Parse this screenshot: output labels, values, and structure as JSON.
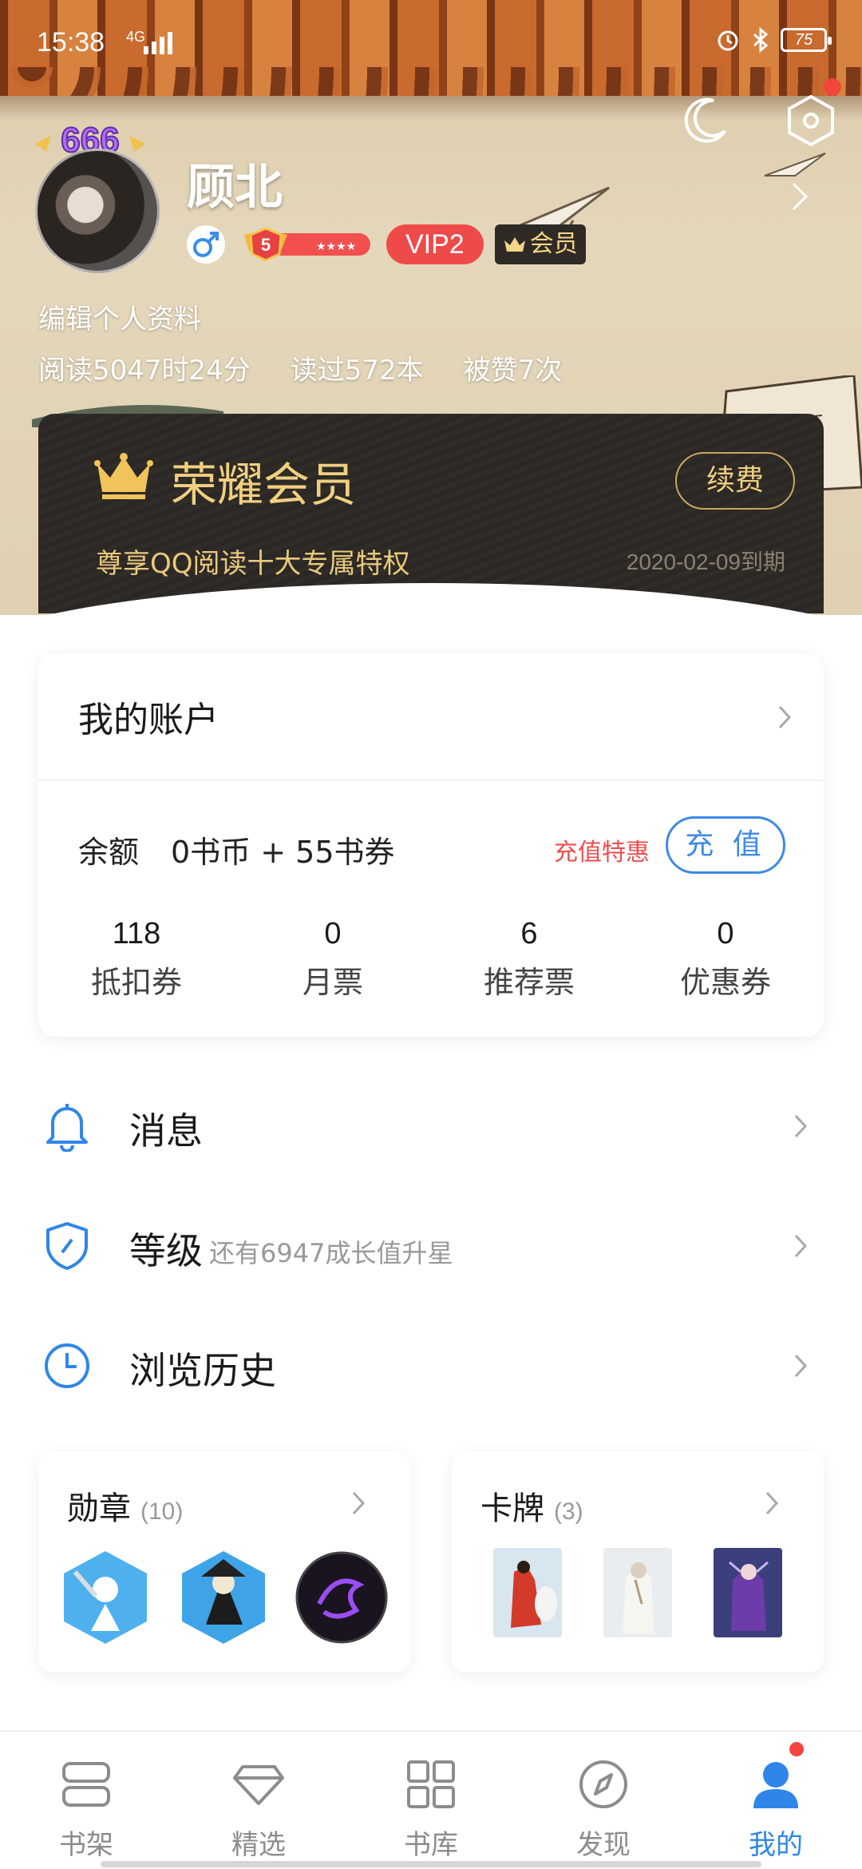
{
  "status_bar": {
    "time": "15:38",
    "network": "4G",
    "battery": "75"
  },
  "profile": {
    "name": "顾北",
    "avatar_badge": "666",
    "level": "5",
    "vip_label": "VIP2",
    "member_label": "会员",
    "edit_label": "编辑个人资料",
    "stats": {
      "read_time": "阅读5047时24分",
      "books_read": "读过572本",
      "likes": "被赞7次"
    }
  },
  "vip_card": {
    "title": "荣耀会员",
    "renew_label": "续费",
    "subtitle": "尊享QQ阅读十大专属特权",
    "expiry": "2020-02-09到期"
  },
  "account": {
    "title": "我的账户",
    "balance_label": "余额",
    "balance_value": "0书币 + 55书券",
    "promo_label": "充值特惠",
    "recharge_label": "充 值",
    "tickets": [
      {
        "value": "118",
        "label": "抵扣券"
      },
      {
        "value": "0",
        "label": "月票"
      },
      {
        "value": "6",
        "label": "推荐票"
      },
      {
        "value": "0",
        "label": "优惠券"
      }
    ]
  },
  "menu": {
    "messages": {
      "label": "消息",
      "icon": "bell-icon"
    },
    "level": {
      "label": "等级",
      "sub": "还有6947成长值升星",
      "icon": "shield-icon"
    },
    "history": {
      "label": "浏览历史",
      "icon": "clock-icon"
    }
  },
  "medals": {
    "title": "勋章",
    "count": "(10)"
  },
  "cards": {
    "title": "卡牌",
    "count": "(3)"
  },
  "bottom_nav": [
    {
      "label": "书架",
      "icon": "bookshelf-icon"
    },
    {
      "label": "精选",
      "icon": "diamond-icon"
    },
    {
      "label": "书库",
      "icon": "grid-icon"
    },
    {
      "label": "发现",
      "icon": "compass-icon"
    },
    {
      "label": "我的",
      "icon": "profile-icon",
      "active": true
    }
  ],
  "colors": {
    "accent": "#2f86e8",
    "vip_gold": "#f0cf7f",
    "vip_red": "#ee4a4a",
    "promo_red": "#ef4e4e",
    "notify_red": "#f2453d"
  }
}
